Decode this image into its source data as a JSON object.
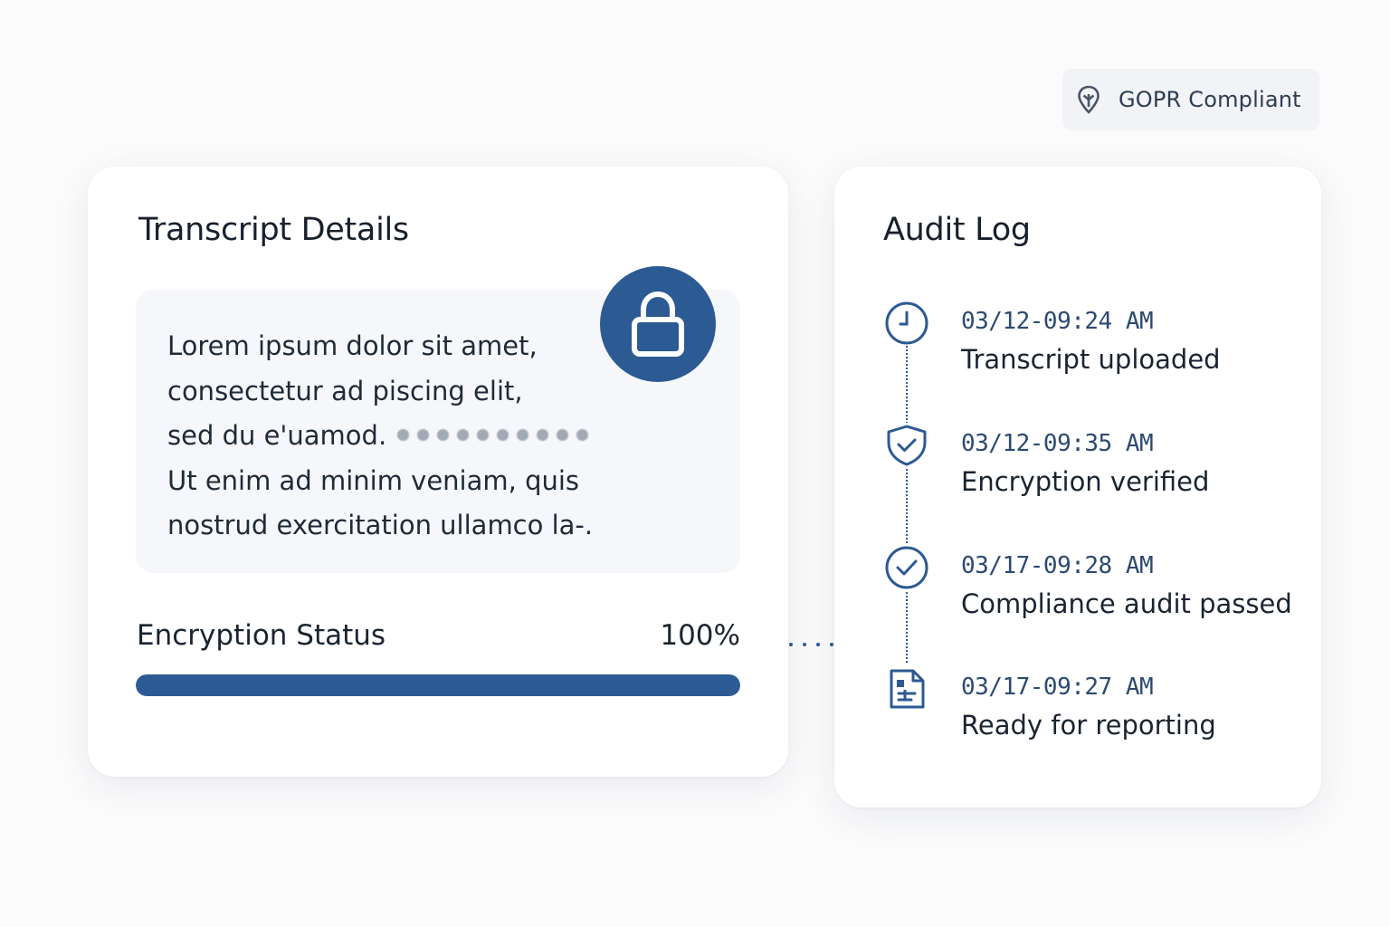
{
  "badge": {
    "label": "GOPR Compliant",
    "icon": "location-pin-icon"
  },
  "transcript": {
    "title": "Transcript Details",
    "lines": [
      "Lorem ipsum dolor sit amet,",
      "consectetur ad piscing elit,",
      "sed du e'uamod.",
      "Ut enim ad minim veniam, quis",
      "nostrud exercitation ullamco la-."
    ],
    "lock_icon": "lock-icon",
    "encryption": {
      "label": "Encryption Status",
      "value_label": "100%",
      "progress": 1.0
    }
  },
  "audit": {
    "title": "Audit Log",
    "entries": [
      {
        "time": "03/12-09:24 AM",
        "event": "Transcript uploaded",
        "icon": "clock-icon"
      },
      {
        "time": "03/12-09:35 AM",
        "event": "Encryption verified",
        "icon": "shield-check-icon"
      },
      {
        "time": "03/17-09:28 AM",
        "event": "Compliance audit passed",
        "icon": "check-circle-icon"
      },
      {
        "time": "03/17-09:27 AM",
        "event": "Ready for reporting",
        "icon": "report-document-icon"
      }
    ]
  },
  "colors": {
    "accent": "#2c5a93",
    "background": "#fbfbfc",
    "card": "#ffffff",
    "text_box": "#f5f7fa"
  }
}
